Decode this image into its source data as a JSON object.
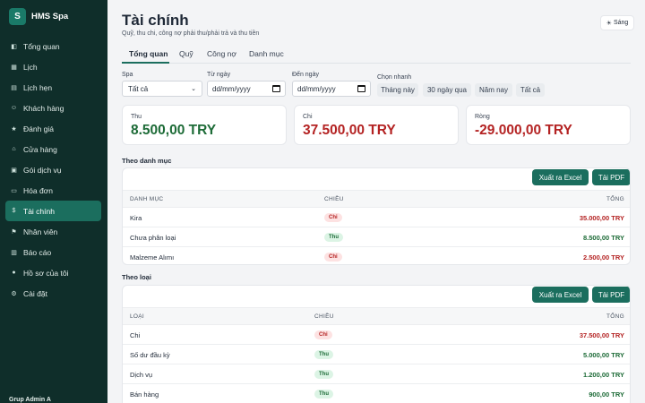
{
  "brand": {
    "logo_letter": "S",
    "name": "HMS Spa"
  },
  "sidebar": {
    "items": [
      {
        "label": "Tổng quan",
        "icon": "◧"
      },
      {
        "label": "Lịch",
        "icon": "▦"
      },
      {
        "label": "Lịch hẹn",
        "icon": "▤"
      },
      {
        "label": "Khách hàng",
        "icon": "☺"
      },
      {
        "label": "Đánh giá",
        "icon": "★"
      },
      {
        "label": "Cửa hàng",
        "icon": "⌂"
      },
      {
        "label": "Gói dịch vụ",
        "icon": "▣"
      },
      {
        "label": "Hóa đơn",
        "icon": "▭"
      },
      {
        "label": "Tài chính",
        "icon": "$"
      },
      {
        "label": "Nhân viên",
        "icon": "⚑"
      },
      {
        "label": "Báo cáo",
        "icon": "▥"
      },
      {
        "label": "Hồ sơ của tôi",
        "icon": "●"
      },
      {
        "label": "Cài đặt",
        "icon": "⚙"
      }
    ],
    "active_index": 8,
    "footer": "Grup Admin A"
  },
  "header": {
    "title": "Tài chính",
    "subtitle": "Quỹ, thu chi, công nợ phải thu/phải trả và thu tiền",
    "theme_icon": "☀",
    "theme_label": "Sáng"
  },
  "tabs": [
    "Tổng quan",
    "Quỹ",
    "Công nợ",
    "Danh mục"
  ],
  "active_tab": 0,
  "filters": {
    "spa_label": "Spa",
    "spa_value": "Tất cả",
    "from_label": "Từ ngày",
    "from_placeholder": "dd/mm/yyyy",
    "to_label": "Đến ngày",
    "to_placeholder": "dd/mm/yyyy",
    "quick_label": "Chọn nhanh",
    "quick_options": [
      "Tháng này",
      "30 ngày qua",
      "Năm nay",
      "Tất cả"
    ]
  },
  "summary": {
    "income_label": "Thu",
    "income_value": "8.500,00 TRY",
    "expense_label": "Chi",
    "expense_value": "37.500,00 TRY",
    "net_label": "Ròng",
    "net_value": "-29.000,00 TRY"
  },
  "by_category": {
    "title": "Theo danh mục",
    "export_excel": "Xuất ra Excel",
    "export_pdf": "Tải PDF",
    "headers": [
      "DANH MỤC",
      "CHIỀU",
      "TỔNG"
    ],
    "rows": [
      {
        "name": "Kira",
        "dir": "Chi",
        "type": "expense",
        "total": "35.000,00 TRY"
      },
      {
        "name": "Chưa phân loại",
        "dir": "Thu",
        "type": "income",
        "total": "8.500,00 TRY"
      },
      {
        "name": "Malzeme Alımı",
        "dir": "Chi",
        "type": "expense",
        "total": "2.500,00 TRY"
      }
    ]
  },
  "by_type": {
    "title": "Theo loại",
    "export_excel": "Xuất ra Excel",
    "export_pdf": "Tải PDF",
    "headers": [
      "LOẠI",
      "CHIỀU",
      "TỔNG"
    ],
    "rows": [
      {
        "name": "Chi",
        "dir": "Chi",
        "type": "expense",
        "total": "37.500,00 TRY"
      },
      {
        "name": "Số dư đầu kỳ",
        "dir": "Thu",
        "type": "income",
        "total": "5.000,00 TRY"
      },
      {
        "name": "Dịch vụ",
        "dir": "Thu",
        "type": "income",
        "total": "1.200,00 TRY"
      },
      {
        "name": "Bán hàng",
        "dir": "Thu",
        "type": "income",
        "total": "900,00 TRY"
      }
    ]
  },
  "colors": {
    "income": "#1d6b37",
    "expense": "#b42323",
    "accent": "#1b6e5e",
    "sidebar_bg": "#0f2e2a"
  }
}
